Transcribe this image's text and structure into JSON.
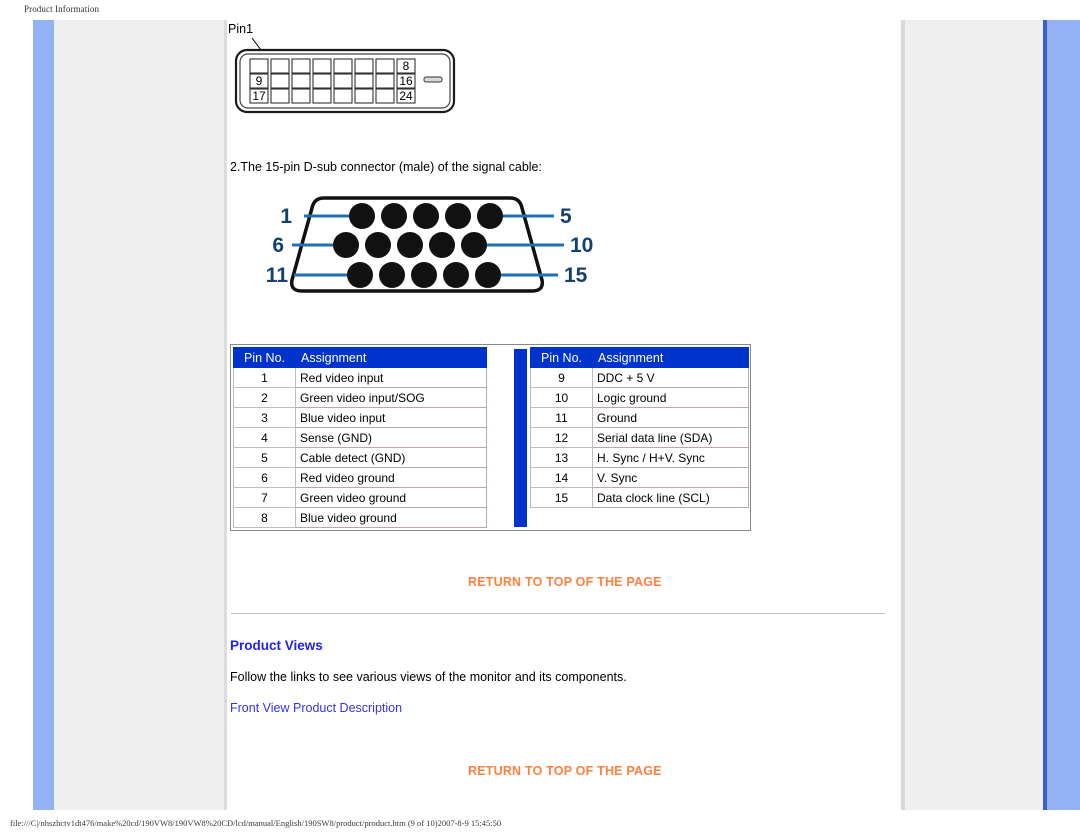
{
  "document": {
    "header_title": "Product Information",
    "status_bar": "file:///C|/nhszhctv1dt476/make%20cd/190VW8/190VW8%20CD/lcd/manual/English/190SW8/product/product.htm (9 of 10)2007-8-9 15:45:50"
  },
  "dvi_connector": {
    "pin1_label": "Pin1",
    "row_end_labels": [
      "8",
      "16",
      "24"
    ],
    "row_start_labels": [
      "",
      "9",
      "17"
    ]
  },
  "dsub": {
    "caption": "2.The 15-pin D-sub connector (male) of the signal cable:",
    "left_labels": [
      "1",
      "6",
      "11"
    ],
    "right_labels": [
      "5",
      "10",
      "15"
    ]
  },
  "pin_tables": {
    "headers": {
      "pin_no": "Pin No.",
      "assignment": "Assignment"
    },
    "left_rows": [
      {
        "pin": "1",
        "assignment": "Red video input"
      },
      {
        "pin": "2",
        "assignment": "Green video input/SOG"
      },
      {
        "pin": "3",
        "assignment": "Blue video input"
      },
      {
        "pin": "4",
        "assignment": "Sense (GND)"
      },
      {
        "pin": "5",
        "assignment": "Cable detect (GND)"
      },
      {
        "pin": "6",
        "assignment": "Red video ground"
      },
      {
        "pin": "7",
        "assignment": "Green video ground"
      },
      {
        "pin": "8",
        "assignment": "Blue video ground"
      }
    ],
    "right_rows": [
      {
        "pin": "9",
        "assignment": "DDC + 5 V"
      },
      {
        "pin": "10",
        "assignment": "Logic ground"
      },
      {
        "pin": "11",
        "assignment": "Ground"
      },
      {
        "pin": "12",
        "assignment": "Serial data line (SDA)"
      },
      {
        "pin": "13",
        "assignment": "H. Sync / H+V. Sync"
      },
      {
        "pin": "14",
        "assignment": "V. Sync"
      },
      {
        "pin": "15",
        "assignment": "Data clock line (SCL)"
      }
    ]
  },
  "links": {
    "return_top_1": "RETURN TO TOP OF THE PAGE",
    "return_top_2": "RETURN TO TOP OF THE PAGE",
    "front_view": "Front View Product Description"
  },
  "product_views": {
    "title": "Product Views",
    "description": "Follow the links to see various views of the monitor and its components."
  },
  "colors": {
    "rail_blue": "#93b1f5",
    "table_header_blue": "#0033cc",
    "link_orange": "#ff8040",
    "link_blue": "#3333ee",
    "sheet_grey": "#efefef"
  }
}
